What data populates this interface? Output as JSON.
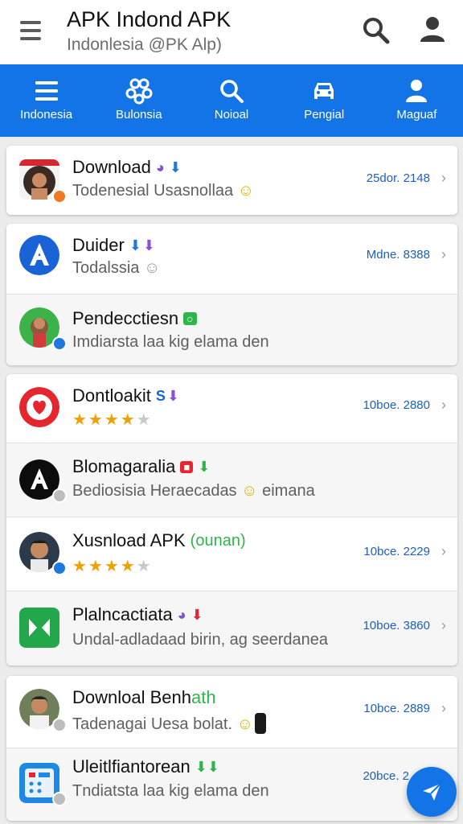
{
  "header": {
    "title": "APK Indond APK",
    "subtitle": "Indonlesia @PK Alp)"
  },
  "nav": {
    "items": [
      {
        "label": "Indonesia",
        "icon": "list-icon"
      },
      {
        "label": "Bulonsia",
        "icon": "apps-icon"
      },
      {
        "label": "Noioal",
        "icon": "search-icon"
      },
      {
        "label": "Pengial",
        "icon": "car-icon"
      },
      {
        "label": "Maguaf",
        "icon": "person-icon"
      }
    ]
  },
  "cards": [
    [
      {
        "name": "Download",
        "sub": "Todenesial Usasnollaa",
        "meta": "25dor. 2148"
      }
    ],
    [
      {
        "name": "Duider",
        "sub": "Todalssia",
        "meta": "Mdne. 8388"
      },
      {
        "name": "Pendecctiesn",
        "sub": "Imdiarsta laa kig elama den",
        "meta": ""
      }
    ],
    [
      {
        "name": "Dontloakit",
        "tag": "S",
        "sub": "",
        "meta": "10boe. 2880",
        "rating": 4
      },
      {
        "name": "Blomagaralia",
        "sub": "Bediosisia Heraecadas",
        "sub_after": "eimana",
        "meta": ""
      },
      {
        "name": "Xusnload APK",
        "tag": "(ounan)",
        "sub": "",
        "meta": "10bce. 2229",
        "rating": 4
      },
      {
        "name": "Plalncactiata",
        "sub": "Undal-adladaad birin, ag seerdanea",
        "meta": "10boe. 3860"
      }
    ],
    [
      {
        "name": "Downloal Benh",
        "name_tail": "ath",
        "sub": "Tadenagai Uesa bolat.",
        "meta": "10bce. 2889"
      },
      {
        "name": "Uleitlfiantorean",
        "sub": "Tndiatsta laa kig elama den",
        "meta": "20bce. 2"
      }
    ]
  ],
  "colors": {
    "accent": "#1274e6",
    "meta_text": "#1e5fb8",
    "star": "#f0a000"
  }
}
